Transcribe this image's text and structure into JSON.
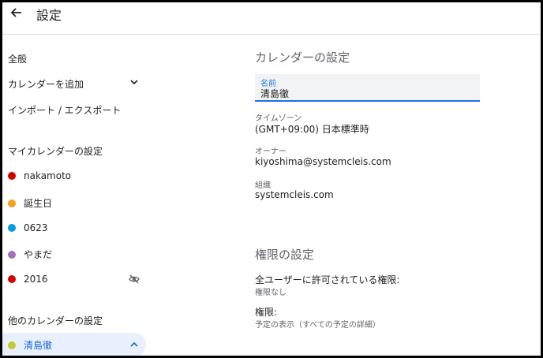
{
  "header": {
    "title": "設定"
  },
  "sidebar": {
    "general": "全般",
    "add_calendar": "カレンダーを追加",
    "import_export": "インポート / エクスポート",
    "my_calendars_heading": "マイカレンダーの設定",
    "my_calendars": [
      {
        "label": "nakamoto",
        "color": "#d50000"
      },
      {
        "label": "誕生日",
        "color": "#f6a31b"
      },
      {
        "label": "0623",
        "color": "#039be5"
      },
      {
        "label": "やまだ",
        "color": "#a46fbd"
      },
      {
        "label": "2016",
        "color": "#d50000",
        "hidden_icon": "visibility-off-icon"
      }
    ],
    "other_calendars_heading": "他のカレンダーの設定",
    "selected_calendar": {
      "label": "清島徹",
      "color": "#c0ca33"
    }
  },
  "main": {
    "calendar_settings_title": "カレンダーの設定",
    "name_field": {
      "label": "名前",
      "value": "清島徹"
    },
    "timezone": {
      "label": "タイムゾーン",
      "value": "(GMT+09:00) 日本標準時"
    },
    "owner": {
      "label": "オーナー",
      "value": "kiyoshima@systemcleis.com"
    },
    "organization": {
      "label": "組織",
      "value": "systemcleis.com"
    },
    "permissions_title": "権限の設定",
    "all_users_permission": {
      "label": "全ユーザーに許可されている権限:",
      "value": "権限なし"
    },
    "permission": {
      "label": "権限:",
      "value": "予定の表示（すべての予定の詳細）"
    }
  },
  "colors": {
    "accent": "#1a73e8",
    "selected_bg": "#e8f0fe"
  }
}
